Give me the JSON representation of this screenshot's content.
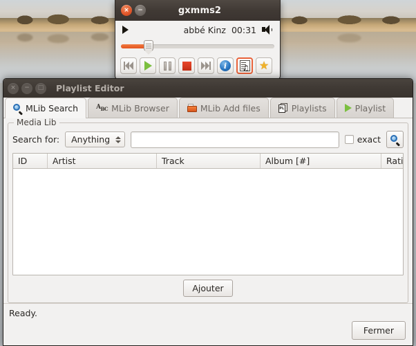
{
  "desktop": {
    "wallpaper_name": "lake-mountain-reflection-wallpaper"
  },
  "player": {
    "title": "gxmms2",
    "window_buttons": [
      {
        "name": "close",
        "glyph": "×"
      },
      {
        "name": "minimize",
        "glyph": "−"
      }
    ],
    "status_icon": "play-triangle-icon",
    "track": "abbé Kinz",
    "time": "00:31",
    "volume_icon": "speaker-icon",
    "seek": {
      "percent": 18
    },
    "buttons": [
      {
        "name": "previous-button",
        "icon": "skip-backward-icon",
        "selected": false
      },
      {
        "name": "play-button",
        "icon": "play-icon",
        "selected": false
      },
      {
        "name": "pause-button",
        "icon": "pause-icon",
        "selected": false
      },
      {
        "name": "stop-button",
        "icon": "stop-icon",
        "selected": false
      },
      {
        "name": "next-button",
        "icon": "skip-forward-icon",
        "selected": false
      },
      {
        "name": "info-button",
        "icon": "info-icon",
        "selected": false
      },
      {
        "name": "playlist-editor-button",
        "icon": "playlist-document-icon",
        "selected": true
      },
      {
        "name": "favorite-button",
        "icon": "star-icon",
        "selected": false
      }
    ]
  },
  "editor": {
    "title": "Playlist Editor",
    "window_buttons": [
      {
        "name": "close",
        "glyph": "×"
      },
      {
        "name": "minimize",
        "glyph": "−"
      },
      {
        "name": "maximize",
        "glyph": "□"
      }
    ],
    "tabs": [
      {
        "label": "MLib Search",
        "icon": "magnifier-icon",
        "active": true
      },
      {
        "label": "MLib Browser",
        "icon": "abc-icon",
        "active": false
      },
      {
        "label": "MLib Add files",
        "icon": "open-folder-icon",
        "active": false
      },
      {
        "label": "Playlists",
        "icon": "playlists-icon",
        "active": false
      },
      {
        "label": "Playlist",
        "icon": "play-triangle-icon",
        "active": false
      }
    ],
    "group": {
      "legend": "Media Lib"
    },
    "search": {
      "label": "Search for:",
      "field_selected": "Anything",
      "field_options": [
        "Anything"
      ],
      "query_value": "",
      "query_placeholder": "",
      "exact_label": "exact",
      "exact_checked": false,
      "search_button_icon": "magnifier-icon"
    },
    "columns": [
      {
        "label": "ID"
      },
      {
        "label": "Artist"
      },
      {
        "label": "Track"
      },
      {
        "label": "Album [#]"
      },
      {
        "label": "Rating"
      }
    ],
    "rows": [],
    "add_button": "Ajouter",
    "status": "Ready.",
    "close_button": "Fermer"
  },
  "colors": {
    "accent_orange": "#e4551f",
    "titlebar_dark": "#3f3934",
    "window_bg": "#f2f1f0",
    "selected_border": "#e8623a"
  }
}
